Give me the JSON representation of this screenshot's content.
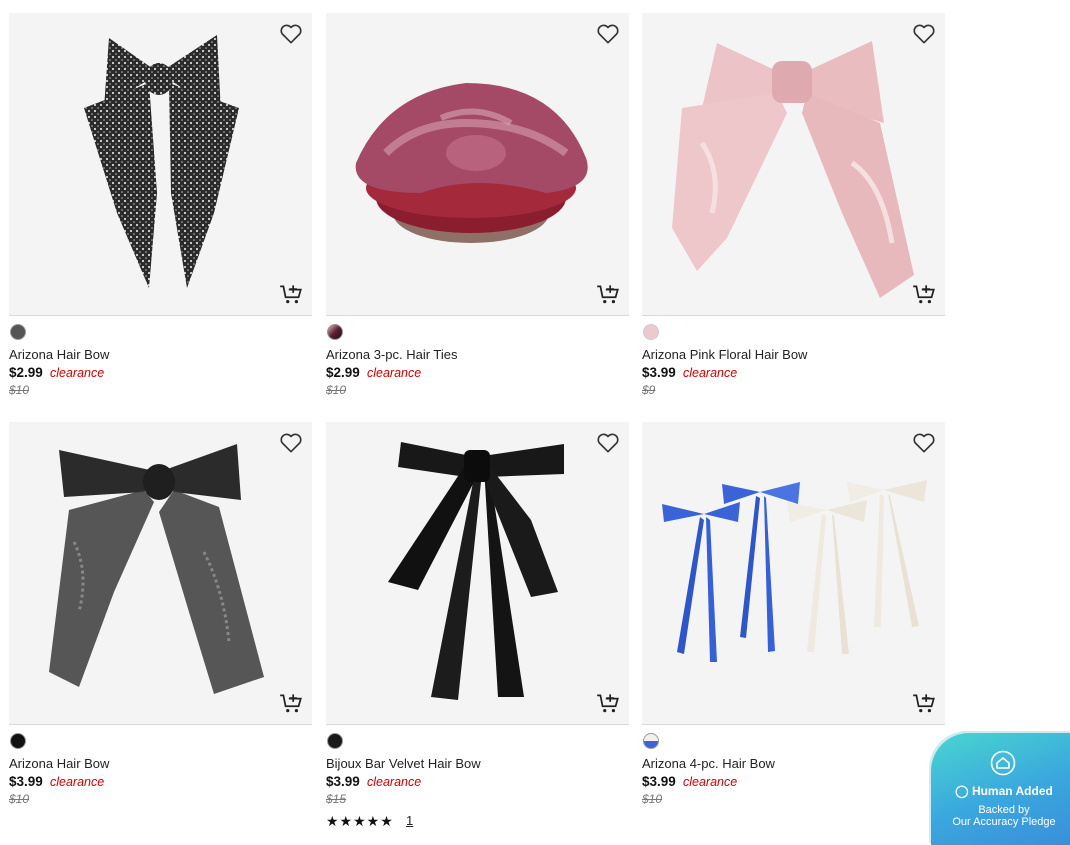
{
  "products": [
    {
      "name": "Arizona Hair Bow",
      "price": "$2.99",
      "badge": "clearance",
      "original_price": "$10",
      "swatch_color": "#555555"
    },
    {
      "name": "Arizona 3-pc. Hair Ties",
      "price": "$2.99",
      "badge": "clearance",
      "original_price": "$10",
      "swatch_color": "#5b2030"
    },
    {
      "name": "Arizona Pink Floral Hair Bow",
      "price": "$3.99",
      "badge": "clearance",
      "original_price": "$9",
      "swatch_color": "#e8c8cc"
    },
    {
      "name": "Arizona Hair Bow",
      "price": "$3.99",
      "badge": "clearance",
      "original_price": "$10",
      "swatch_color": "#111111"
    },
    {
      "name": "Bijoux Bar Velvet Hair Bow",
      "price": "$3.99",
      "badge": "clearance",
      "original_price": "$15",
      "swatch_color": "#1a1a1a",
      "rating_stars": "★★★★★",
      "rating_count": "1"
    },
    {
      "name": "Arizona 4-pc. Hair Bow",
      "price": "$3.99",
      "badge": "clearance",
      "original_price": "$10",
      "swatch_color": "#3b63d6"
    }
  ],
  "badge": {
    "line1": "Human Added",
    "line2": "Backed by",
    "line3": "Our Accuracy Pledge"
  },
  "icons": {
    "favorite": "heart-icon",
    "add_to_cart": "cart-plus-icon",
    "badge": "house-icon"
  },
  "colors": {
    "clearance": "#cc0000",
    "badge_gradient_start": "#49d6d0",
    "badge_gradient_end": "#3a8fd9"
  }
}
